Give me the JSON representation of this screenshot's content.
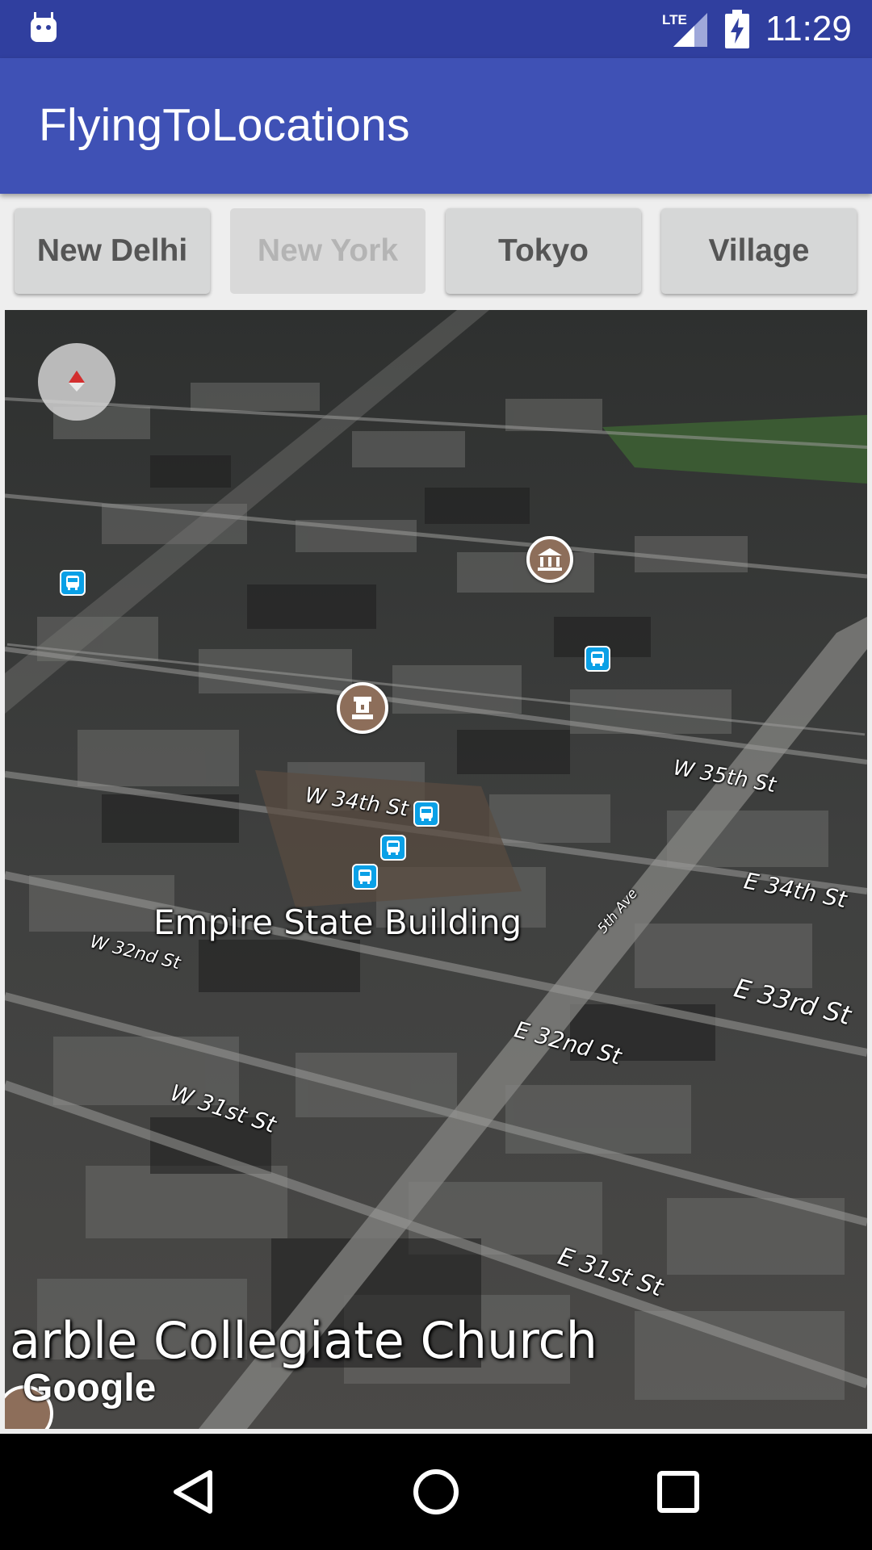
{
  "status_bar": {
    "time": "11:29",
    "network": "LTE",
    "icons": [
      "android-robot-icon",
      "lte-signal-icon",
      "battery-charging-icon"
    ]
  },
  "app_bar": {
    "title": "FlyingToLocations",
    "color": "#3f51b5"
  },
  "buttons": [
    {
      "label": "New Delhi",
      "enabled": true
    },
    {
      "label": "New York",
      "enabled": false
    },
    {
      "label": "Tokyo",
      "enabled": true
    },
    {
      "label": "Village",
      "enabled": true
    }
  ],
  "map": {
    "place_label": "Empire State Building",
    "bottom_label": "arble Collegiate Church",
    "attribution": "Google",
    "streets": {
      "w34": "W 34th St",
      "w35": "W 35th St",
      "e34": "E 34th St",
      "w32": "W 32nd St",
      "fifth": "5th Ave",
      "e33": "E 33rd St",
      "e32": "E 32nd St",
      "w31": "W 31st St",
      "e31": "E 31st St"
    }
  },
  "nav_bar": {
    "buttons": [
      "back-icon",
      "home-icon",
      "recents-icon"
    ]
  }
}
